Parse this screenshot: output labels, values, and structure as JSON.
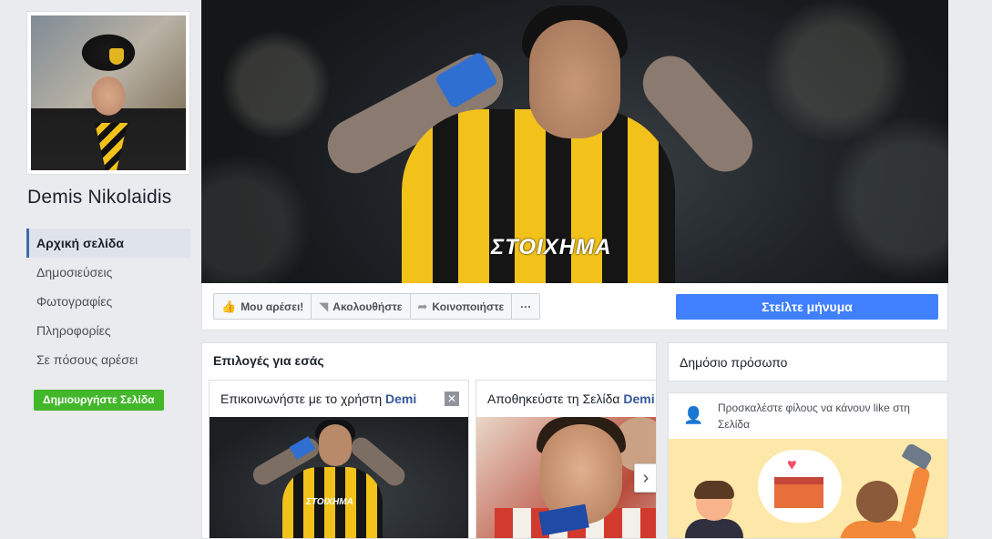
{
  "page": {
    "name": "Demis Nikolaidis",
    "category": "Δημόσιο πρόσωπο"
  },
  "sidebar": {
    "items": [
      {
        "label": "Αρχική σελίδα",
        "active": true
      },
      {
        "label": "Δημοσιεύσεις",
        "active": false
      },
      {
        "label": "Φωτογραφίες",
        "active": false
      },
      {
        "label": "Πληροφορίες",
        "active": false
      },
      {
        "label": "Σε πόσους αρέσει",
        "active": false
      }
    ],
    "create_page_label": "Δημιουργήστε Σελίδα"
  },
  "cover": {
    "jersey_text": "ΣΤΟΙΧΗΜΑ"
  },
  "actions": {
    "like_label": "Μου αρέσει!",
    "follow_label": "Ακολουθήστε",
    "share_label": "Κοινοποιήστε",
    "more_label": "···",
    "send_message_label": "Στείλτε μήνυμα"
  },
  "suggestions": {
    "title": "Επιλογές για εσάς",
    "cards": [
      {
        "text": "Επικοινωνήστε με το χρήστη ",
        "name": "Demi",
        "close": "✕",
        "photo_text": "ΣΤΟΙΧΗΜΑ"
      },
      {
        "text": "Αποθηκεύστε τη Σελίδα ",
        "name": "Demi"
      }
    ],
    "next_arrow": "›"
  },
  "invite": {
    "text": "Προσκαλέστε φίλους να κάνουν like στη Σελίδα"
  },
  "colors": {
    "brand_blue": "#4267b2",
    "send_button": "#4080ff",
    "create_button": "#42b72a",
    "background": "#e9ebee"
  },
  "icons": {
    "like": "thumbs-up-icon",
    "follow": "rss-icon",
    "share": "share-arrow-icon",
    "invite": "add-friend-icon",
    "close": "close-icon",
    "next": "chevron-right-icon"
  }
}
